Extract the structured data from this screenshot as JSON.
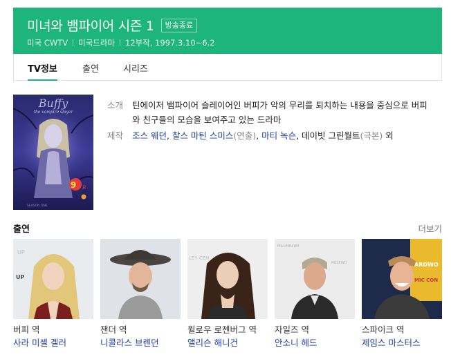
{
  "header": {
    "title": "미녀와 뱀파이어 시즌 1",
    "badge": "방송종료",
    "meta": [
      "미국 CWTV",
      "미국드라마",
      "12부작, 1997.3.10~6.2"
    ],
    "bg_color": "#1db57b"
  },
  "tabs": [
    {
      "label": "TV정보",
      "active": true
    },
    {
      "label": "출연",
      "active": false
    },
    {
      "label": "시리즈",
      "active": false
    }
  ],
  "poster": {
    "logo_text": "Buffy",
    "subtitle_text": "the vampire slayer",
    "season_text": "SEASON ONE"
  },
  "info": {
    "synopsis_label": "소개",
    "synopsis": "틴에이저 뱀파이어 슬레이어인 버피가 악의 무리를 퇴치하는 내용을 중심으로 버피와 친구들의 모습을 보여주고 있는 드라마",
    "crew_label": "제작",
    "crew": {
      "p1": "조스 웨던",
      "p2": "찰스 마틴 스미스",
      "p2_role": "(연출)",
      "p3": "마티 녹슨",
      "p4_plain": "데이빗 그린월트",
      "p4_role": "(극본)",
      "suffix": "외"
    }
  },
  "cast": {
    "title": "출연",
    "more": "더보기",
    "members": [
      {
        "role": "버피 역",
        "name": "사라 미셸 겔러"
      },
      {
        "role": "잰더 역",
        "name": "니콜라스 브렌던"
      },
      {
        "role": "윌로우 로젠버그 역",
        "name": "앨리슨 해니건"
      },
      {
        "role": "자일즈 역",
        "name": "안소니 헤드"
      },
      {
        "role": "스파이크 역",
        "name": "제임스 마스터스"
      }
    ]
  }
}
